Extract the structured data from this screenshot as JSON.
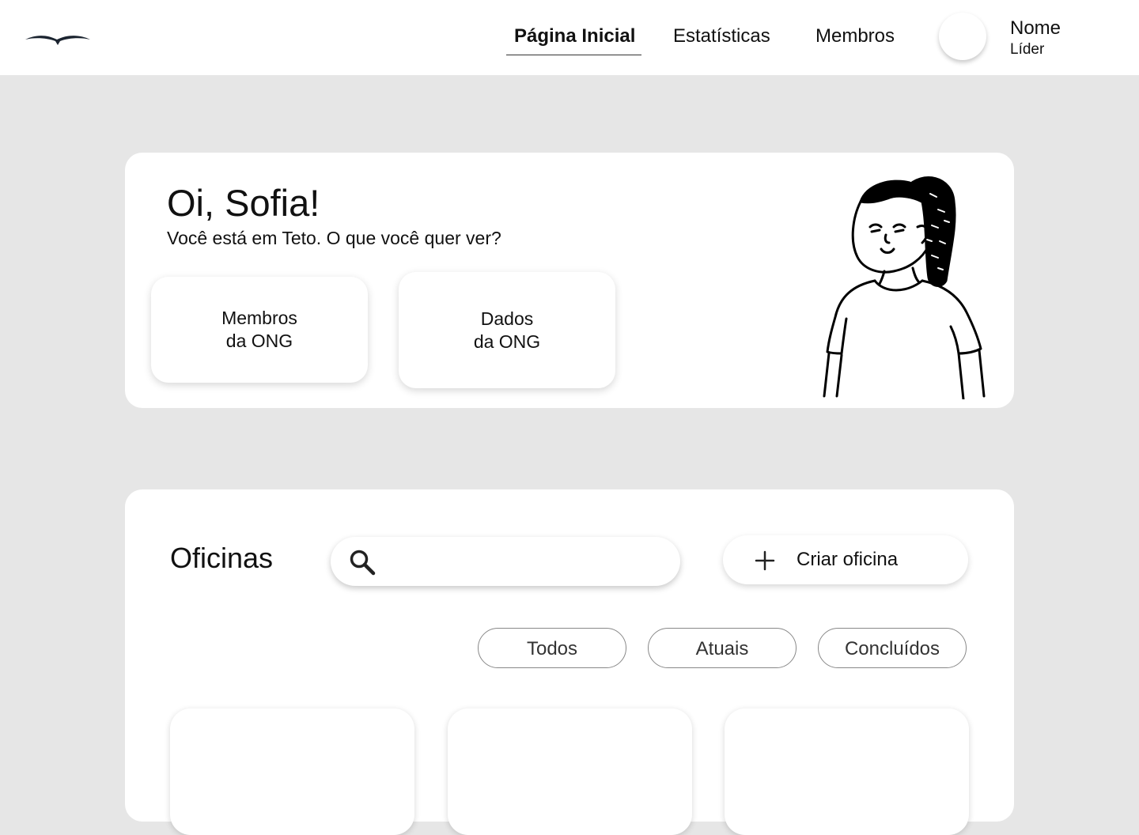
{
  "header": {
    "nav": [
      {
        "label": "Página Inicial",
        "active": true
      },
      {
        "label": "Estatísticas",
        "active": false
      },
      {
        "label": "Membros",
        "active": false
      }
    ],
    "user": {
      "name": "Nome",
      "role": "Líder"
    }
  },
  "welcome": {
    "greeting": "Oi, Sofia!",
    "subtitle": "Você está em Teto. O que você quer ver?",
    "cards": [
      {
        "line1": "Membros",
        "line2": "da ONG"
      },
      {
        "line1": "Dados",
        "line2": "da ONG"
      }
    ]
  },
  "workshops": {
    "title": "Oficinas",
    "search": {
      "value": "",
      "placeholder": ""
    },
    "create_label": "Criar oficina",
    "filters": [
      "Todos",
      "Atuais",
      "Concluídos"
    ]
  },
  "icons": {
    "logo": "bird-logo-icon",
    "search": "search-icon",
    "add": "plus-icon"
  }
}
